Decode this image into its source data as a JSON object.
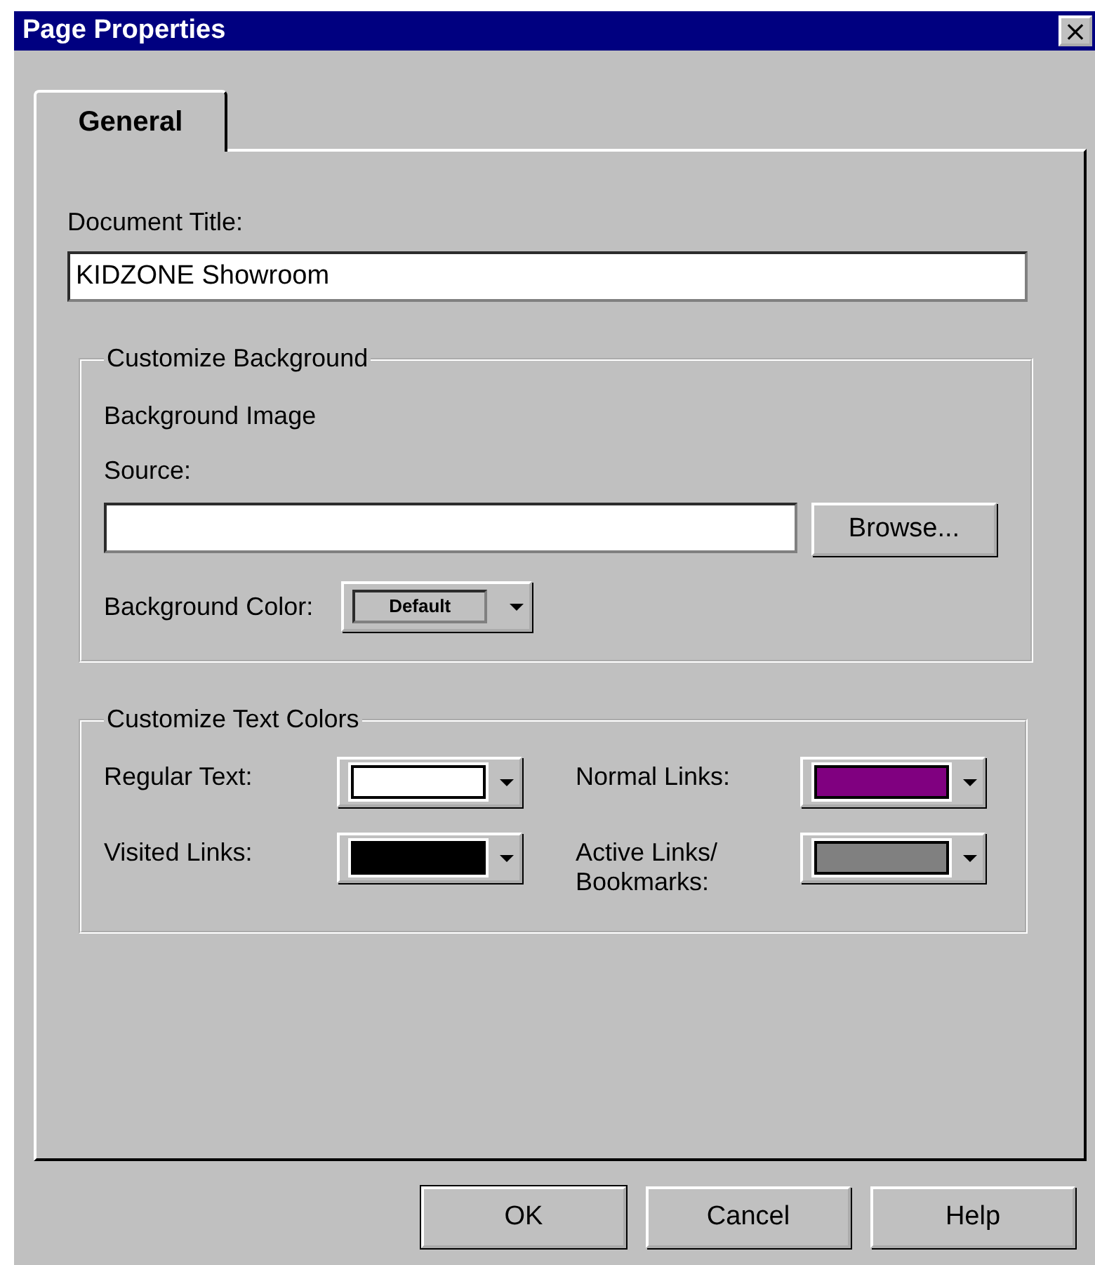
{
  "window": {
    "title": "Page Properties",
    "close": "×"
  },
  "tabs": [
    {
      "label": "General",
      "selected": true
    }
  ],
  "document_title": {
    "label": "Document Title:",
    "value": "KIDZONE Showroom"
  },
  "background": {
    "legend": "Customize Background",
    "image_label": "Background Image",
    "source_label": "Source:",
    "browse": "Browse...",
    "color_label": "Background Color:",
    "color_picker": {
      "kind": "default",
      "text": "Default"
    }
  },
  "text_colors": {
    "legend": "Customize Text Colors",
    "items": [
      {
        "label": "Regular Text:",
        "kind": "swatch",
        "color": "#ffffff"
      },
      {
        "label": "Normal Links:",
        "kind": "swatch",
        "color": "#800080"
      },
      {
        "label": "Visited Links:",
        "kind": "swatch",
        "color": "#000000"
      },
      {
        "label": "Active Links/ Bookmarks:",
        "kind": "swatch",
        "color": "#808080"
      }
    ]
  },
  "buttons": [
    {
      "label": "OK",
      "default": true
    },
    {
      "label": "Cancel",
      "default": false
    },
    {
      "label": "Help",
      "default": false
    }
  ]
}
